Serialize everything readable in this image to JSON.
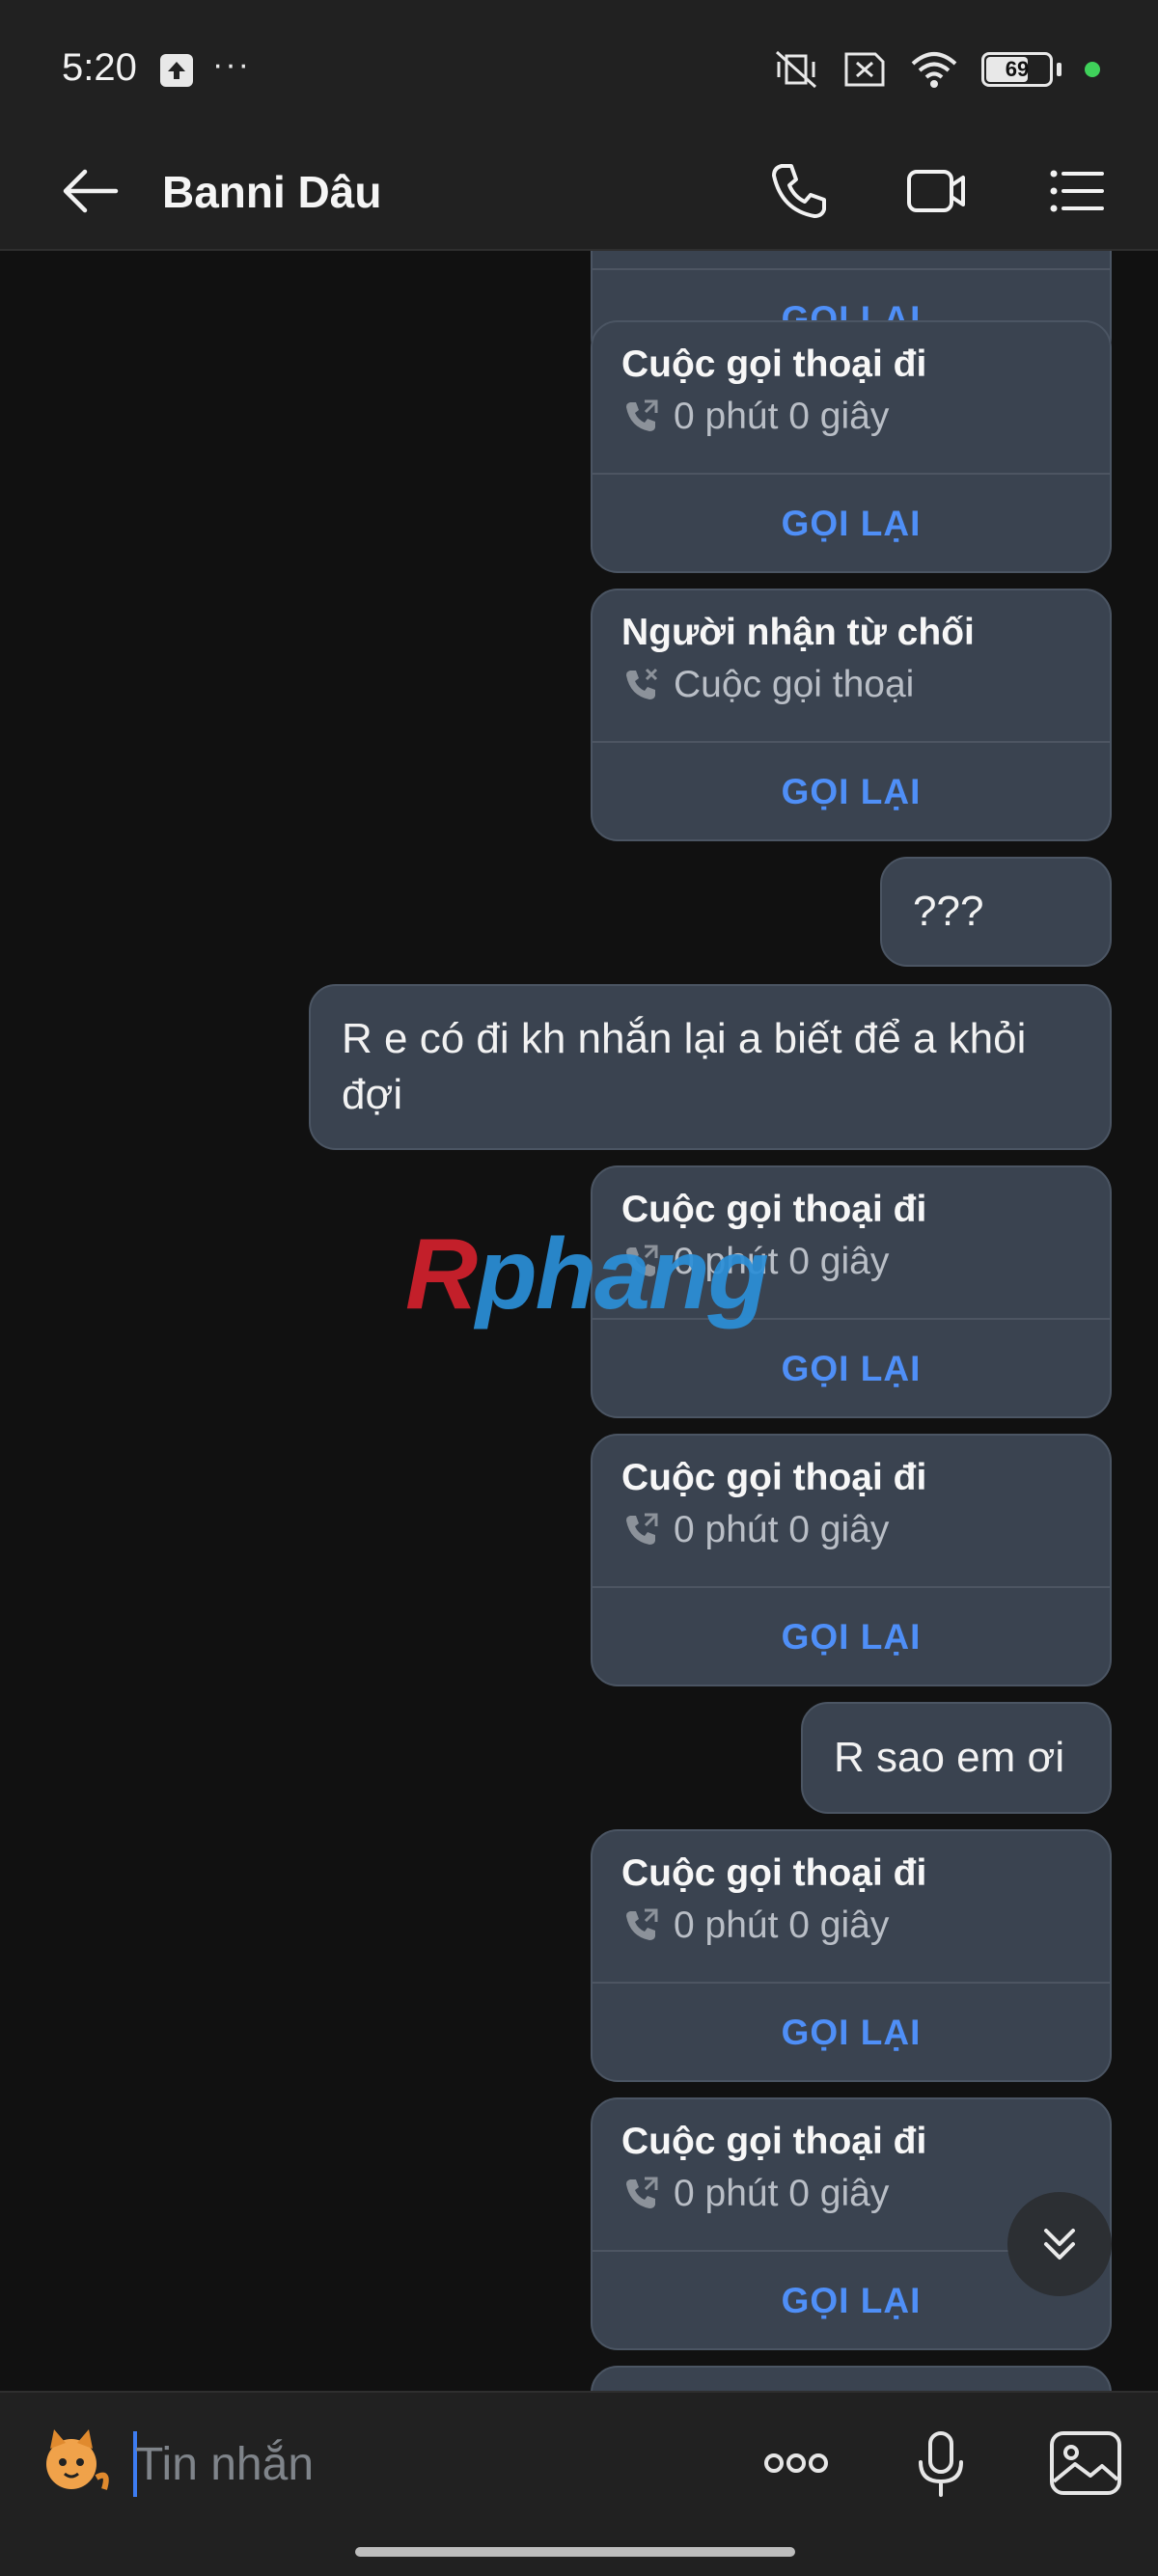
{
  "status_bar": {
    "time": "5:20",
    "battery": "69"
  },
  "header": {
    "contact_name": "Banni Dâu"
  },
  "messages": [
    {
      "kind": "call",
      "title": "",
      "detail": "",
      "action": "GỌI LẠI"
    },
    {
      "kind": "call",
      "title": "Cuộc gọi thoại đi",
      "detail": "0 phút 0 giây",
      "action": "GỌI LẠI"
    },
    {
      "kind": "call",
      "title": "Người nhận từ chối",
      "detail": "Cuộc gọi thoại",
      "action": "GỌI LẠI"
    },
    {
      "kind": "text",
      "text": "???"
    },
    {
      "kind": "text",
      "text": "R e có đi kh nhắn lại a biết để a khỏi đợi"
    },
    {
      "kind": "call",
      "title": "Cuộc gọi thoại đi",
      "detail": "0 phút 0 giây",
      "action": "GỌI LẠI"
    },
    {
      "kind": "call",
      "title": "Cuộc gọi thoại đi",
      "detail": "0 phút 0 giây",
      "action": "GỌI LẠI"
    },
    {
      "kind": "text",
      "text": "R sao em ơi"
    },
    {
      "kind": "call",
      "title": "Cuộc gọi thoại đi",
      "detail": "0 phút 0 giây",
      "action": "GỌI LẠI"
    },
    {
      "kind": "call",
      "title": "Cuộc gọi thoại đi",
      "detail": "0 phút 0 giây",
      "action": "GỌI LẠI"
    }
  ],
  "watermark": {
    "first": "R",
    "rest": "phang"
  },
  "composer": {
    "placeholder": "Tin nhắn"
  },
  "icons": {
    "back": "arrow-left-icon",
    "call": "phone-icon",
    "video": "video-camera-icon",
    "menu": "list-menu-icon",
    "more": "more-horizontal-icon",
    "mic": "microphone-icon",
    "gallery": "image-icon",
    "scroll": "chevron-double-down-icon"
  },
  "colors": {
    "accent": "#4f8ff7",
    "bubble": "#3a4350",
    "background": "#111111"
  }
}
